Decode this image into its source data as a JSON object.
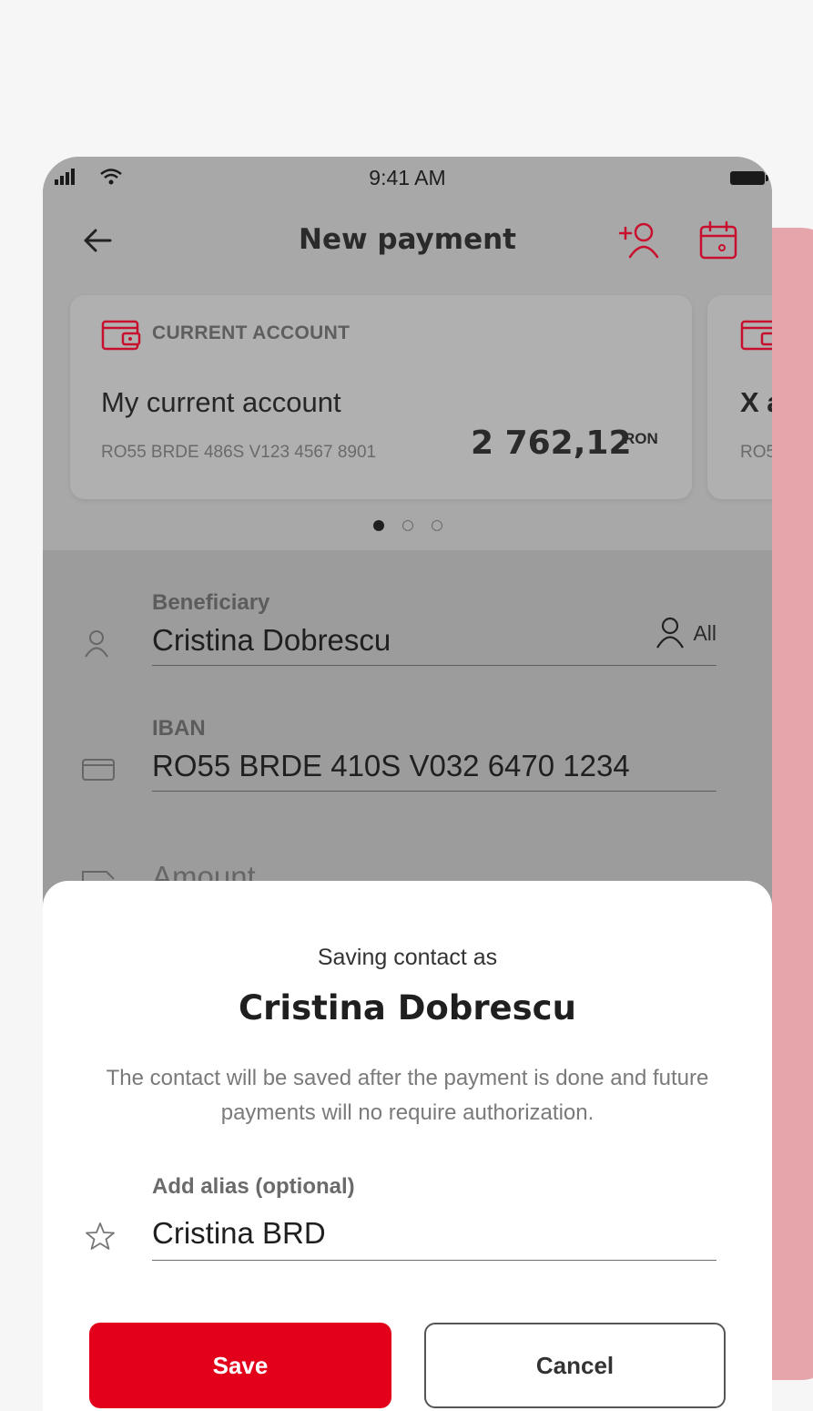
{
  "status_bar": {
    "time": "9:41 AM"
  },
  "header": {
    "title": "New payment"
  },
  "accounts": [
    {
      "type": "CURRENT ACCOUNT",
      "name": "My current account",
      "iban": "RO55 BRDE 486S V123 4567 8901",
      "balance": "2 762,12",
      "currency": "RON"
    },
    {
      "name": "X a",
      "iban": "RO5"
    }
  ],
  "form": {
    "beneficiary": {
      "label": "Beneficiary",
      "value": "Cristina Dobrescu",
      "all_label": "All"
    },
    "iban": {
      "label": "IBAN",
      "value": "RO55 BRDE 410S V032 6470 1234"
    },
    "amount": {
      "label": "Amount"
    }
  },
  "sheet": {
    "subtitle": "Saving contact as",
    "name": "Cristina Dobrescu",
    "description": "The contact will be saved after the payment is done and future payments will no require authorization.",
    "alias_label": "Add alias (optional)",
    "alias_value": "Cristina BRD",
    "save_label": "Save",
    "cancel_label": "Cancel"
  },
  "colors": {
    "brand_red": "#e2001a",
    "overlay": "#a8a8a8",
    "pink_panel": "#e6a5ab"
  }
}
